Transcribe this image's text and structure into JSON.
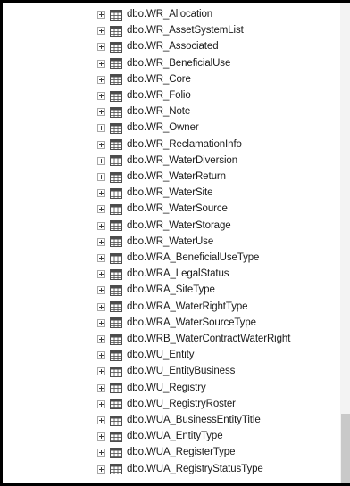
{
  "object_explorer": {
    "tables": [
      {
        "label": "dbo.WR_Allocation"
      },
      {
        "label": "dbo.WR_AssetSystemList"
      },
      {
        "label": "dbo.WR_Associated"
      },
      {
        "label": "dbo.WR_BeneficialUse"
      },
      {
        "label": "dbo.WR_Core"
      },
      {
        "label": "dbo.WR_Folio"
      },
      {
        "label": "dbo.WR_Note"
      },
      {
        "label": "dbo.WR_Owner"
      },
      {
        "label": "dbo.WR_ReclamationInfo"
      },
      {
        "label": "dbo.WR_WaterDiversion"
      },
      {
        "label": "dbo.WR_WaterReturn"
      },
      {
        "label": "dbo.WR_WaterSite"
      },
      {
        "label": "dbo.WR_WaterSource"
      },
      {
        "label": "dbo.WR_WaterStorage"
      },
      {
        "label": "dbo.WR_WaterUse"
      },
      {
        "label": "dbo.WRA_BeneficialUseType"
      },
      {
        "label": "dbo.WRA_LegalStatus"
      },
      {
        "label": "dbo.WRA_SiteType"
      },
      {
        "label": "dbo.WRA_WaterRightType"
      },
      {
        "label": "dbo.WRA_WaterSourceType"
      },
      {
        "label": "dbo.WRB_WaterContractWaterRight"
      },
      {
        "label": "dbo.WU_Entity"
      },
      {
        "label": "dbo.WU_EntityBusiness"
      },
      {
        "label": "dbo.WU_Registry"
      },
      {
        "label": "dbo.WU_RegistryRoster"
      },
      {
        "label": "dbo.WUA_BusinessEntityTitle"
      },
      {
        "label": "dbo.WUA_EntityType"
      },
      {
        "label": "dbo.WUA_RegisterType"
      },
      {
        "label": "dbo.WUA_RegistryStatusType"
      }
    ],
    "icons": {
      "expander": "plus-box-icon",
      "table": "table-icon"
    },
    "colors": {
      "frame_border": "#000000",
      "text": "#1a1a1a",
      "table_icon": "#4d4d4d",
      "scrollbar_track": "#f3f3f3",
      "scrollbar_thumb": "#c9c9c9"
    }
  }
}
